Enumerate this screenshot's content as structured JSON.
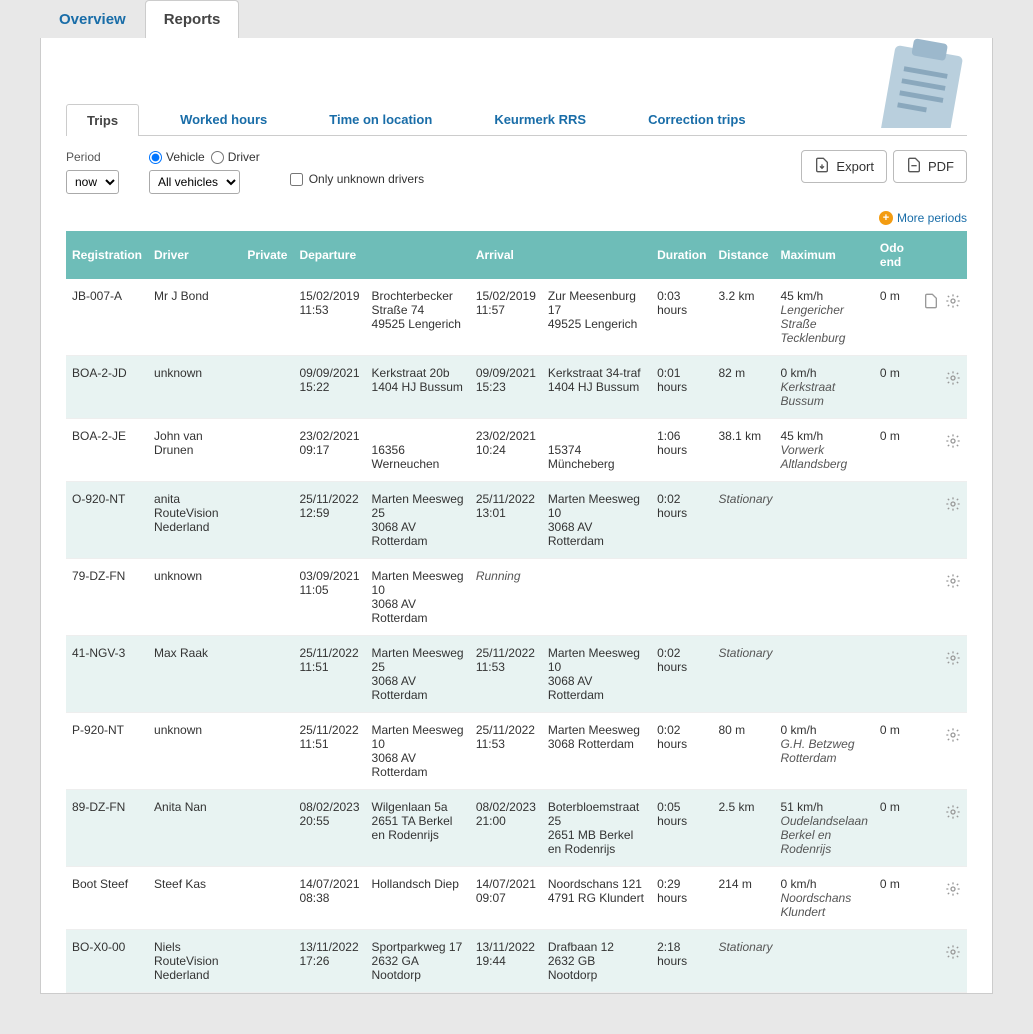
{
  "topTabs": {
    "overview": "Overview",
    "reports": "Reports"
  },
  "subTabs": {
    "trips": "Trips",
    "worked": "Worked hours",
    "time": "Time on location",
    "keurmerk": "Keurmerk RRS",
    "correction": "Correction trips"
  },
  "labels": {
    "period": "Period",
    "vehicle": "Vehicle",
    "driver": "Driver",
    "unknownOnly": "Only unknown drivers",
    "export": "Export",
    "pdf": "PDF",
    "morePeriods": "More periods"
  },
  "selects": {
    "period": "now",
    "vehicles": "All vehicles"
  },
  "headers": {
    "registration": "Registration",
    "driver": "Driver",
    "private": "Private",
    "departure": "Departure",
    "arrival": "Arrival",
    "duration": "Duration",
    "distance": "Distance",
    "maximum": "Maximum",
    "odo": "Odo end"
  },
  "rows": [
    {
      "reg": "JB-007-A",
      "driver": "Mr J Bond",
      "depTime": "15/02/2019 11:53",
      "depAddr": "Brochterbecker Straße 74\n49525 Lengerich",
      "arrTime": "15/02/2019 11:57",
      "arrAddr": "Zur Meesenburg 17\n49525 Lengerich",
      "duration": "0:03 hours",
      "distance": "3.2 km",
      "max": "45 km/h",
      "maxLoc": "Lengericher Straße Tecklenburg",
      "odo": "0 m",
      "hasDoc": true
    },
    {
      "reg": "BOA-2-JD",
      "driver": "unknown",
      "depTime": "09/09/2021 15:22",
      "depAddr": "Kerkstraat 20b\n1404 HJ Bussum",
      "arrTime": "09/09/2021 15:23",
      "arrAddr": "Kerkstraat 34-traf\n1404 HJ Bussum",
      "duration": "0:01 hours",
      "distance": "82 m",
      "max": "0 km/h",
      "maxLoc": "Kerkstraat Bussum",
      "odo": "0 m"
    },
    {
      "reg": "BOA-2-JE",
      "driver": "John van Drunen",
      "depTime": "23/02/2021 09:17",
      "depAddr": "\n16356 Werneuchen",
      "arrTime": "23/02/2021 10:24",
      "arrAddr": "\n15374 Müncheberg",
      "duration": "1:06 hours",
      "distance": "38.1 km",
      "max": "45 km/h",
      "maxLoc": "Vorwerk Altlandsberg",
      "odo": "0 m"
    },
    {
      "reg": "O-920-NT",
      "driver": "anita RouteVision Nederland",
      "depTime": "25/11/2022 12:59",
      "depAddr": "Marten Meesweg 25\n3068 AV Rotterdam",
      "arrTime": "25/11/2022 13:01",
      "arrAddr": "Marten Meesweg 10\n3068 AV Rotterdam",
      "duration": "0:02 hours",
      "distance": "",
      "status": "Stationary",
      "max": "",
      "odo": ""
    },
    {
      "reg": "79-DZ-FN",
      "driver": "unknown",
      "depTime": "03/09/2021 11:05",
      "depAddr": "Marten Meesweg 10\n3068 AV Rotterdam",
      "arrStatus": "Running",
      "duration": "",
      "distance": "",
      "max": "",
      "odo": ""
    },
    {
      "reg": "41-NGV-3",
      "driver": "Max Raak",
      "depTime": "25/11/2022 11:51",
      "depAddr": "Marten Meesweg 25\n3068 AV Rotterdam",
      "arrTime": "25/11/2022 11:53",
      "arrAddr": "Marten Meesweg 10\n3068 AV Rotterdam",
      "duration": "0:02 hours",
      "distance": "",
      "status": "Stationary",
      "max": "",
      "odo": ""
    },
    {
      "reg": "P-920-NT",
      "driver": "unknown",
      "depTime": "25/11/2022 11:51",
      "depAddr": "Marten Meesweg 10\n3068 AV Rotterdam",
      "arrTime": "25/11/2022 11:53",
      "arrAddr": "Marten Meesweg\n3068 Rotterdam",
      "duration": "0:02 hours",
      "distance": "80 m",
      "max": "0 km/h",
      "maxLoc": "G.H. Betzweg Rotterdam",
      "odo": "0 m"
    },
    {
      "reg": "89-DZ-FN",
      "driver": "Anita Nan",
      "depTime": "08/02/2023 20:55",
      "depAddr": "Wilgenlaan 5a\n2651 TA Berkel en Rodenrijs",
      "arrTime": "08/02/2023 21:00",
      "arrAddr": "Boterbloemstraat 25\n2651 MB Berkel en Rodenrijs",
      "duration": "0:05 hours",
      "distance": "2.5 km",
      "max": "51 km/h",
      "maxLoc": "Oudelandselaan Berkel en Rodenrijs",
      "odo": "0 m"
    },
    {
      "reg": "Boot Steef",
      "driver": "Steef Kas",
      "depTime": "14/07/2021 08:38",
      "depAddr": "Hollandsch Diep",
      "arrTime": "14/07/2021 09:07",
      "arrAddr": "Noordschans 121\n4791 RG Klundert",
      "duration": "0:29 hours",
      "distance": "214 m",
      "max": "0 km/h",
      "maxLoc": "Noordschans Klundert",
      "odo": "0 m"
    },
    {
      "reg": "BO-X0-00",
      "driver": "Niels RouteVision Nederland",
      "depTime": "13/11/2022 17:26",
      "depAddr": "Sportparkweg 17\n2632 GA Nootdorp",
      "arrTime": "13/11/2022 19:44",
      "arrAddr": "Drafbaan 12\n2632 GB Nootdorp",
      "duration": "2:18 hours",
      "distance": "",
      "status": "Stationary",
      "max": "",
      "odo": ""
    }
  ]
}
